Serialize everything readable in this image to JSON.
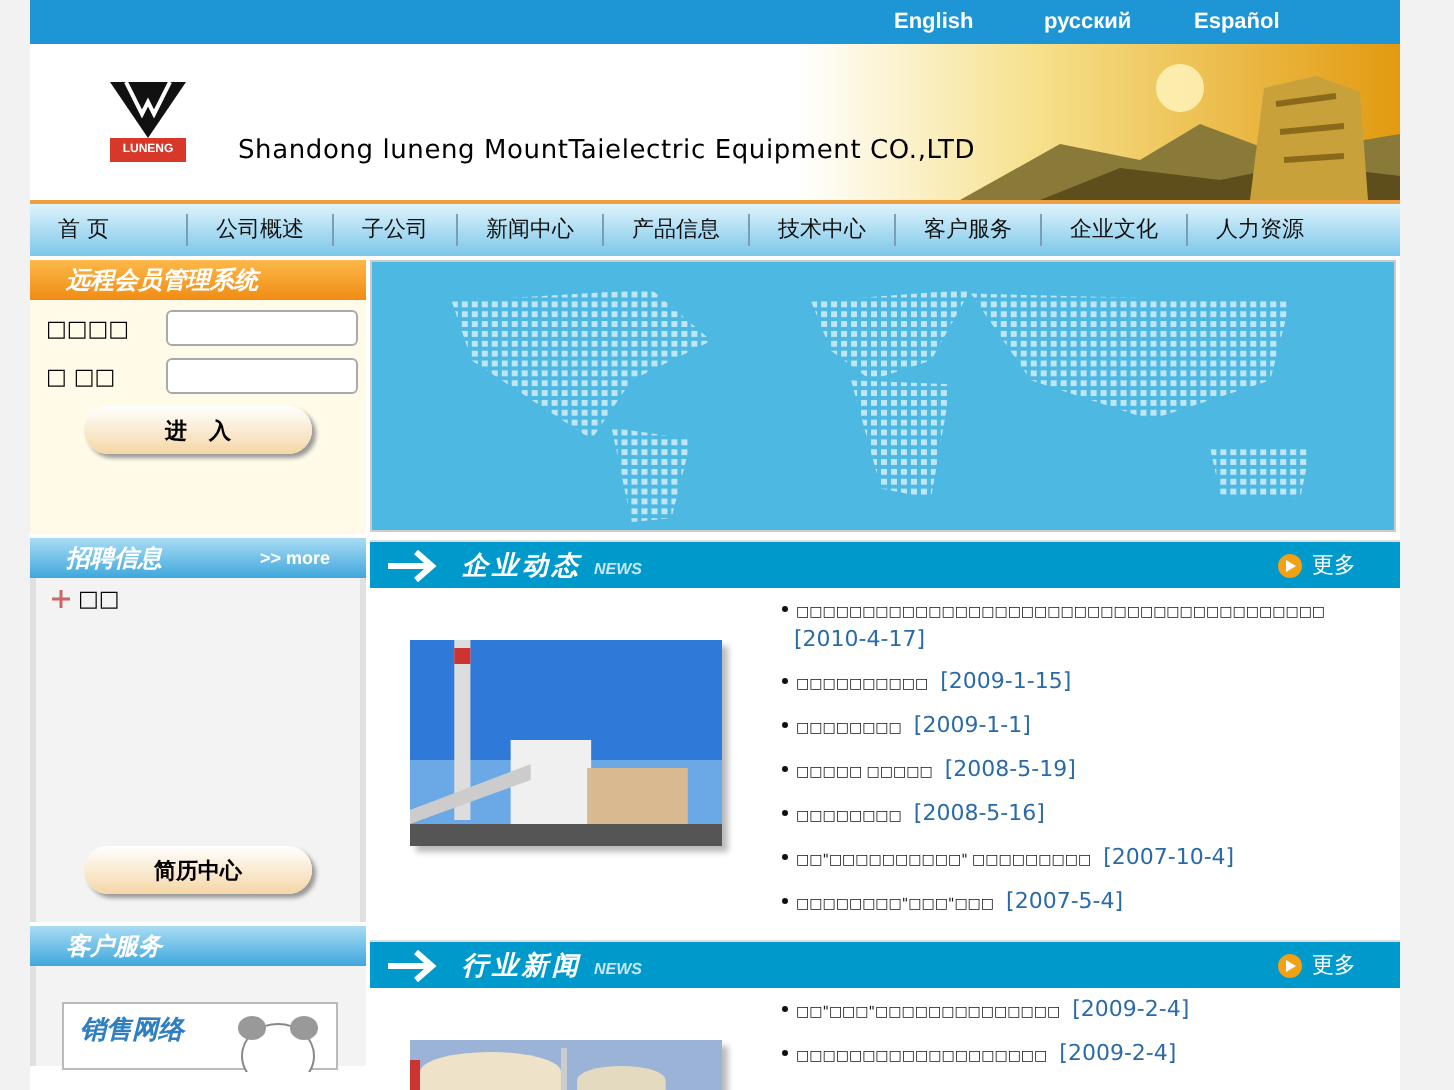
{
  "languages": [
    "English",
    "русский",
    "Español"
  ],
  "company_name": "Shandong luneng MountTaielectric Equipment CO.,LTD",
  "logo_text": "LUNENG",
  "nav": [
    "首 页",
    "公司概述",
    "子公司",
    "新闻中心",
    "产品信息",
    "技术中心",
    "客户服务",
    "企业文化",
    "人力资源"
  ],
  "login": {
    "title": "远程会员管理系统",
    "fields": [
      {
        "label": "□□□□"
      },
      {
        "label": "□ □□"
      }
    ],
    "button": "进　入"
  },
  "jobs": {
    "title": "招聘信息",
    "more": ">> more",
    "items": [
      "□□"
    ],
    "button": "简历中心"
  },
  "service": {
    "title": "客户服务",
    "banner": "销售网络"
  },
  "sections": [
    {
      "title": "企业动态",
      "tag": "NEWS",
      "more": "更多",
      "items": [
        {
          "text": "□□□□□□□□□□□□□□□□□□□□□□□□□□□□□□□□□□□□□□□□",
          "date": "[2010-4-17]"
        },
        {
          "text": "□□□□□□□□□□",
          "date": "[2009-1-15]"
        },
        {
          "text": "□□□□□□□□",
          "date": "[2009-1-1]"
        },
        {
          "text": "□□□□□ □□□□□",
          "date": "[2008-5-19]"
        },
        {
          "text": "□□□□□□□□",
          "date": "[2008-5-16]"
        },
        {
          "text": "□□\"□□□□□□□□□□\" □□□□□□□□□",
          "date": "[2007-10-4]"
        },
        {
          "text": "□□□□□□□□\"□□□\"□□□",
          "date": "[2007-5-4]"
        }
      ]
    },
    {
      "title": "行业新闻",
      "tag": "NEWS",
      "more": "更多",
      "items": [
        {
          "text": "□□\"□□□\"□□□□□□□□□□□□□□",
          "date": "[2009-2-4]"
        },
        {
          "text": "□□□□□□□□□□□□□□□□□□□",
          "date": "[2009-2-4]"
        }
      ]
    }
  ]
}
